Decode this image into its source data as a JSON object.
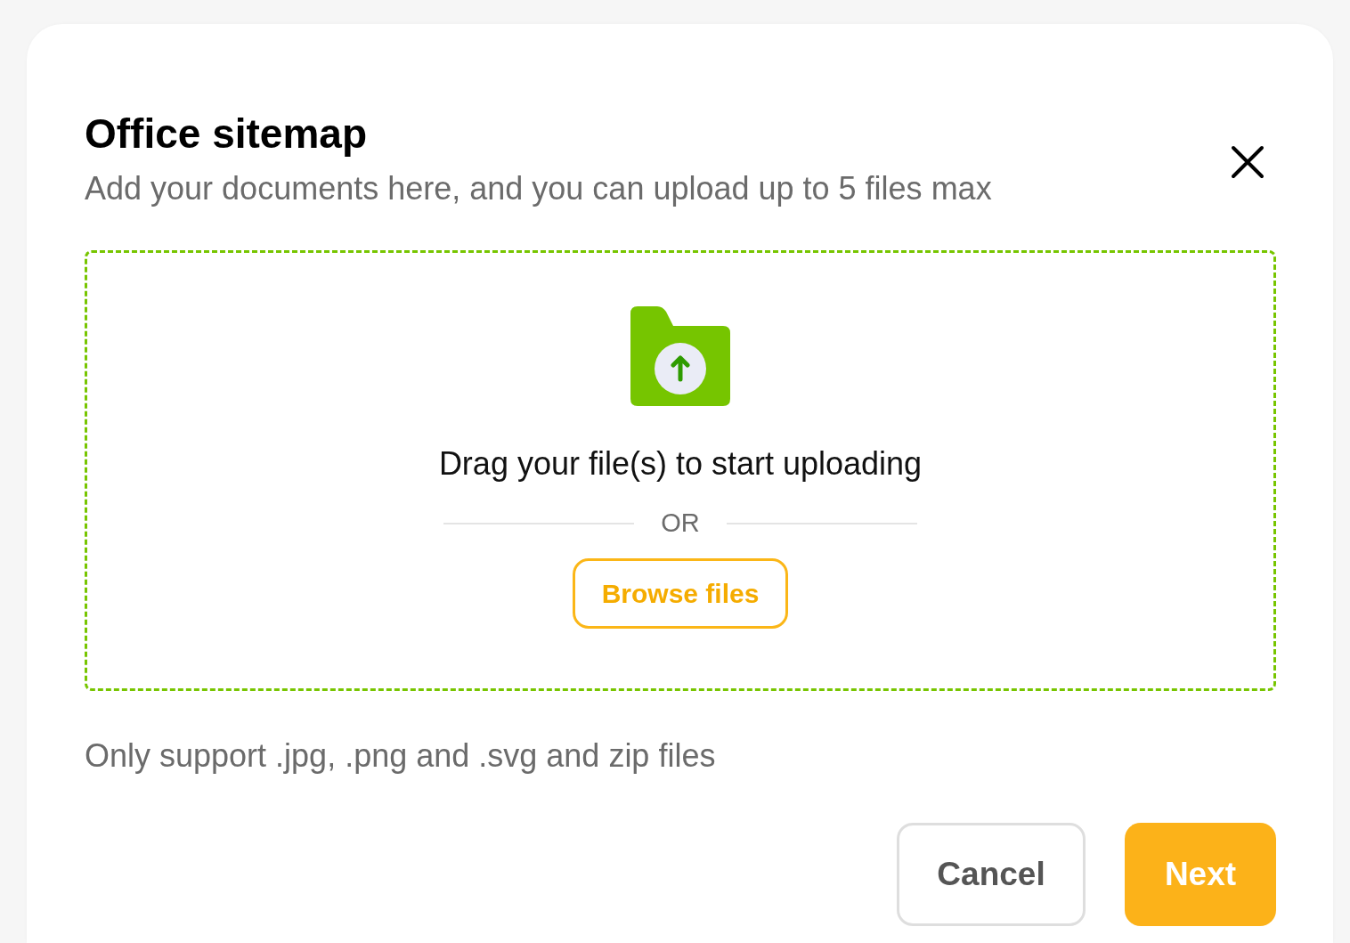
{
  "dialog": {
    "title": "Office sitemap",
    "subtitle": "Add your documents here, and you can upload up to 5 files max"
  },
  "dropzone": {
    "prompt": "Drag your file(s) to start uploading",
    "separator": "OR",
    "browse_button": "Browse files"
  },
  "note": "Only support .jpg, .png and .svg and zip files",
  "buttons": [
    {
      "label": "Cancel",
      "kind": "secondary"
    },
    {
      "label": "Next",
      "kind": "primary"
    }
  ]
}
